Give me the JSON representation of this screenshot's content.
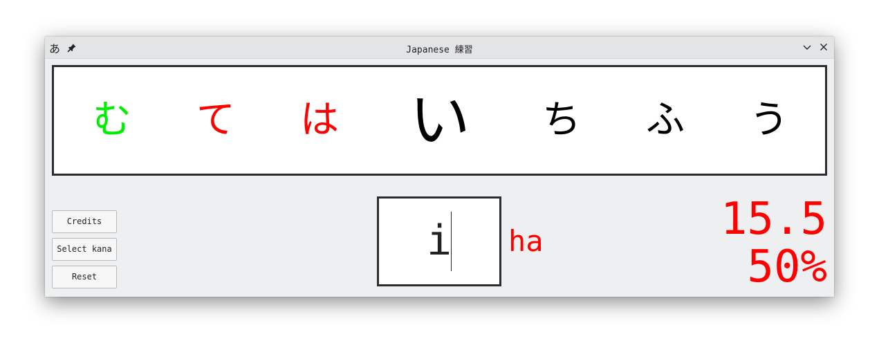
{
  "window": {
    "app_icon": "あ",
    "title": "Japanese 練習",
    "pin_icon": "pin-icon",
    "minimize_icon": "chevron-down-icon",
    "close_icon": "close-icon"
  },
  "kana_strip": [
    {
      "char": "む",
      "state": "correct",
      "color": "#00ee00"
    },
    {
      "char": "て",
      "state": "wrong",
      "color": "#ff0000"
    },
    {
      "char": "は",
      "state": "wrong",
      "color": "#ff0000"
    },
    {
      "char": "い",
      "state": "current",
      "color": "#000000"
    },
    {
      "char": "ち",
      "state": "upcoming",
      "color": "#000000"
    },
    {
      "char": "ふ",
      "state": "upcoming",
      "color": "#000000"
    },
    {
      "char": "う",
      "state": "upcoming",
      "color": "#000000"
    }
  ],
  "buttons": {
    "credits": "Credits",
    "select_kana": "Select kana",
    "reset": "Reset"
  },
  "answer": {
    "value": "i"
  },
  "hint": {
    "text": "ha",
    "color": "#ff0000"
  },
  "stats": {
    "time": "15.5",
    "accuracy": "50%",
    "color": "#ff0000"
  }
}
